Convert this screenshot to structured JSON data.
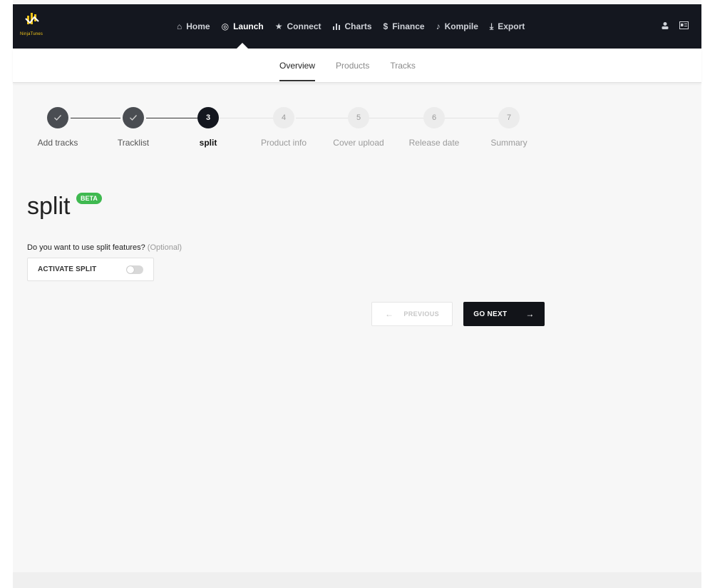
{
  "brand": {
    "name": "NinjaTunes"
  },
  "nav": {
    "items": [
      {
        "label": "Home",
        "icon": "home-icon",
        "glyph": "⌂",
        "active": false
      },
      {
        "label": "Launch",
        "icon": "launch-icon",
        "glyph": "◎",
        "active": true
      },
      {
        "label": "Connect",
        "icon": "star-icon",
        "glyph": "★",
        "active": false
      },
      {
        "label": "Charts",
        "icon": "bar-chart-icon",
        "glyph": "▐",
        "active": false
      },
      {
        "label": "Finance",
        "icon": "dollar-icon",
        "glyph": "$",
        "active": false
      },
      {
        "label": "Kompile",
        "icon": "music-note-icon",
        "glyph": "♪",
        "active": false
      },
      {
        "label": "Export",
        "icon": "download-icon",
        "glyph": "⤓",
        "active": false
      }
    ],
    "right_icons": [
      "user-icon",
      "id-card-icon"
    ]
  },
  "subnav": {
    "tabs": [
      {
        "label": "Overview",
        "active": true
      },
      {
        "label": "Products",
        "active": false
      },
      {
        "label": "Tracks",
        "active": false
      }
    ]
  },
  "stepper": {
    "steps": [
      {
        "number": "1",
        "label": "Add tracks",
        "state": "done"
      },
      {
        "number": "2",
        "label": "Tracklist",
        "state": "done"
      },
      {
        "number": "3",
        "label": "split",
        "state": "current"
      },
      {
        "number": "4",
        "label": "Product info",
        "state": "todo"
      },
      {
        "number": "5",
        "label": "Cover upload",
        "state": "todo"
      },
      {
        "number": "6",
        "label": "Release date",
        "state": "todo"
      },
      {
        "number": "7",
        "label": "Summary",
        "state": "todo"
      }
    ]
  },
  "main": {
    "title": "split",
    "badge": "BETA",
    "question": "Do you want to use split features?",
    "question_optional": "(Optional)",
    "toggle_label": "ACTIVATE SPLIT",
    "toggle_on": false
  },
  "actions": {
    "previous_label": "PREVIOUS",
    "next_label": "GO NEXT"
  },
  "colors": {
    "topbar": "#14171f",
    "beta": "#3fb950",
    "primary_button": "#121419"
  }
}
